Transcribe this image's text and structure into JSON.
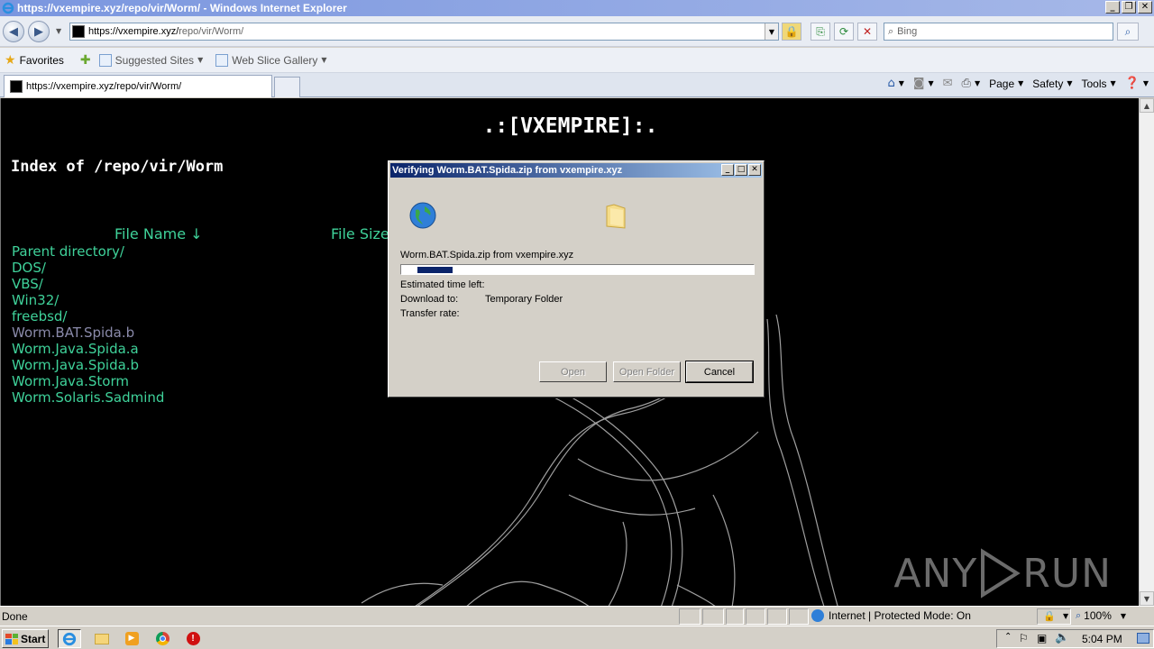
{
  "window": {
    "title": "https://vxempire.xyz/repo/vir/Worm/ - Windows Internet Explorer"
  },
  "address": {
    "url_host": "https://vxempire.xyz/",
    "url_path": "repo/vir/Worm/"
  },
  "search": {
    "placeholder": "Bing"
  },
  "favorites_bar": {
    "favorites_label": "Favorites",
    "suggested_sites": "Suggested Sites",
    "web_slice_gallery": "Web Slice Gallery"
  },
  "tab": {
    "title": "https://vxempire.xyz/repo/vir/Worm/"
  },
  "command_bar": {
    "page": "Page",
    "safety": "Safety",
    "tools": "Tools"
  },
  "page": {
    "site_title": ".:[VXEMPIRE]:.",
    "index_title": "Index of /repo/vir/Worm",
    "col_file_name": "File Name  ↓",
    "col_file_size": "File Size",
    "entries": [
      "Parent directory/",
      "DOS/",
      "VBS/",
      "Win32/",
      "freebsd/",
      "Worm.BAT.Spida.b",
      "Worm.Java.Spida.a",
      "Worm.Java.Spida.b",
      "Worm.Java.Storm",
      "Worm.Solaris.Sadmind"
    ],
    "watermark": {
      "left": "ANY",
      "right": "RUN"
    }
  },
  "dialog": {
    "title": "Verifying Worm.BAT.Spida.zip from vxempire.xyz",
    "file_line": "Worm.BAT.Spida.zip from vxempire.xyz",
    "progress_fraction": 0.1,
    "est_label": "Estimated time left:",
    "dl_label": "Download to:",
    "dl_value": "Temporary Folder",
    "rate_label": "Transfer rate:",
    "open_btn": "Open",
    "open_folder_btn": "Open Folder",
    "cancel_btn": "Cancel"
  },
  "status": {
    "left": "Done",
    "zone": "Internet | Protected Mode: On",
    "zoom": "100%"
  },
  "taskbar": {
    "start": "Start",
    "clock": "5:04 PM"
  },
  "colors": {
    "link_green": "#3fd29a",
    "visited": "#8a8aaa",
    "dialog_title": "#0a246a"
  }
}
